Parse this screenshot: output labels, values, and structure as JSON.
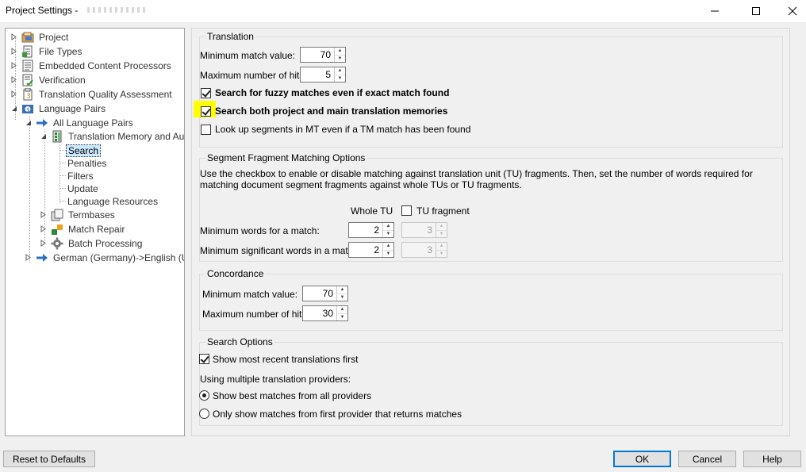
{
  "window": {
    "title": "Project Settings - "
  },
  "tree": {
    "items": [
      {
        "label": "Project",
        "icon": "project-icon"
      },
      {
        "label": "File Types",
        "icon": "file-types-icon"
      },
      {
        "label": "Embedded Content Processors",
        "icon": "embedded-content-icon"
      },
      {
        "label": "Verification",
        "icon": "verification-icon"
      },
      {
        "label": "Translation Quality Assessment",
        "icon": "tqa-icon"
      },
      {
        "label": "Language Pairs",
        "icon": "language-pairs-icon"
      },
      {
        "label": "All Language Pairs",
        "icon": "arrow-right-icon"
      },
      {
        "label": "Translation Memory and Aut",
        "icon": "tm-icon"
      },
      {
        "label": "Search"
      },
      {
        "label": "Penalties"
      },
      {
        "label": "Filters"
      },
      {
        "label": "Update"
      },
      {
        "label": "Language Resources"
      },
      {
        "label": "Termbases",
        "icon": "termbases-icon"
      },
      {
        "label": "Match Repair",
        "icon": "match-repair-icon"
      },
      {
        "label": "Batch Processing",
        "icon": "gear-icon"
      },
      {
        "label": "German (Germany)->English (U",
        "icon": "arrow-right-icon"
      }
    ]
  },
  "translation": {
    "title": "Translation",
    "min_match_label": "Minimum match value:",
    "min_match_value": "70",
    "max_hits_label": "Maximum number of hits:",
    "max_hits_value": "5",
    "fuzzy_label": "Search for fuzzy matches even if exact match found",
    "fuzzy_checked": true,
    "both_label": "Search both project and main translation memories",
    "both_checked": true,
    "mt_label": "Look up segments in MT even if a TM match has been found",
    "mt_checked": false,
    "highlight_color": "#ffff00"
  },
  "fragment": {
    "title": "Segment Fragment Matching Options",
    "description": "Use the checkbox to enable or disable matching against translation unit (TU) fragments. Then, set the number of words required for matching document segment fragments against whole TUs or TU fragments.",
    "col_whole": "Whole TU",
    "col_fragment": "TU fragment",
    "fragment_checked": false,
    "min_words_label": "Minimum words for a match:",
    "min_words_whole": "2",
    "min_words_fragment": "3",
    "min_sig_label": "Minimum significant words in a match:",
    "min_sig_whole": "2",
    "min_sig_fragment": "3"
  },
  "concordance": {
    "title": "Concordance",
    "min_match_label": "Minimum match value:",
    "min_match_value": "70",
    "max_hits_label": "Maximum number of hits:",
    "max_hits_value": "30"
  },
  "search_options": {
    "title": "Search Options",
    "recent_label": "Show most recent translations first",
    "recent_checked": true,
    "multi_label": "Using multiple translation providers:",
    "best_label": "Show best matches from all providers",
    "first_label": "Only show matches from first provider that returns matches",
    "selected": "best"
  },
  "footer": {
    "reset": "Reset to Defaults",
    "ok": "OK",
    "cancel": "Cancel",
    "help": "Help"
  }
}
